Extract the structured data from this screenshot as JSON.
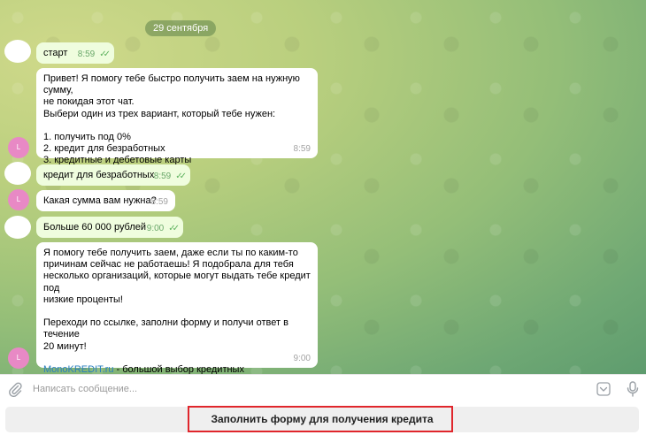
{
  "chat": {
    "date": "29 сентября",
    "messages": [
      {
        "text": "старт",
        "time": "8:59"
      },
      {
        "text": "Привет! Я помогу тебе быстро получить заем на нужную сумму,\nне покидая этот чат.\nВыбери один из трех вариант, который тебе нужен:\n\n1. получить под 0%\n2. кредит для безработных\n3. кредитные и дебетовые карты",
        "time": "8:59"
      },
      {
        "text": "кредит для безработных",
        "time": "8:59"
      },
      {
        "text": "Какая сумма вам нужна?",
        "time": "8:59"
      },
      {
        "text": "Больше 60 000 рублей",
        "time": "9:00"
      },
      {
        "text_before_link": "Я помогу тебе получить заем, даже если ты по каким-то\nпричинам сейчас не работаешь! Я подобрала для тебя\nнесколько организаций, которые могут выдать тебе кредит под\nнизкие проценты!\n\nПереходи по ссылке, заполни форму и получи ответ в течение\n20 минут!\n\n",
        "link": "MonoKREDIT.ru",
        "text_after_link": " - большой выбор кредитных возможностей!\nВыдадим кредит даже если у вас есть просрочки!",
        "time": "9:00"
      }
    ],
    "avatar_letter": "L",
    "read_marks": "✓✓"
  },
  "input": {
    "placeholder": "Написать сообщение..."
  },
  "keyboard": {
    "button_label": "Заполнить форму для получения кредита"
  },
  "colors": {
    "outgoing_bubble": "#effdde",
    "incoming_bubble": "#ffffff",
    "avatar_bot": "#e889c5",
    "highlight": "#e0262c"
  },
  "icons": [
    "paperclip-icon",
    "emoji-icon",
    "microphone-icon",
    "double-check-icon"
  ]
}
